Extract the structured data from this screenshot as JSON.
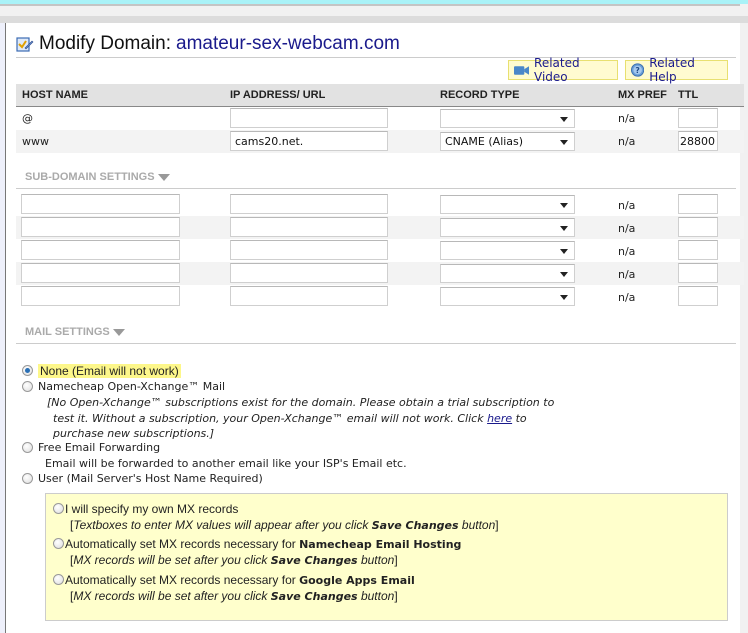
{
  "header": {
    "title": "Modify Domain:",
    "domain": "amateur-sex-webcam.com",
    "related_video": "Related Video",
    "related_help": "Related Help"
  },
  "table": {
    "columns": [
      "HOST NAME",
      "IP ADDRESS/ URL",
      "RECORD TYPE",
      "MX PREF",
      "TTL"
    ],
    "rows": [
      {
        "host": "@",
        "address": "",
        "record_type": "",
        "mx_pref": "n/a",
        "ttl": ""
      },
      {
        "host": "www",
        "address": "cams20.net.",
        "record_type": "CNAME (Alias)",
        "mx_pref": "n/a",
        "ttl": "28800"
      }
    ]
  },
  "subdomain": {
    "label": "SUB-DOMAIN SETTINGS",
    "rows": [
      {
        "host": "",
        "address": "",
        "record_type": "",
        "mx_pref": "n/a",
        "ttl": ""
      },
      {
        "host": "",
        "address": "",
        "record_type": "",
        "mx_pref": "n/a",
        "ttl": ""
      },
      {
        "host": "",
        "address": "",
        "record_type": "",
        "mx_pref": "n/a",
        "ttl": ""
      },
      {
        "host": "",
        "address": "",
        "record_type": "",
        "mx_pref": "n/a",
        "ttl": ""
      },
      {
        "host": "",
        "address": "",
        "record_type": "",
        "mx_pref": "n/a",
        "ttl": ""
      }
    ]
  },
  "mail": {
    "label": "MAIL SETTINGS",
    "selected": "none",
    "options": {
      "none": "None (Email will not work)",
      "openxchange": "Namecheap Open-Xchange™ Mail",
      "openxchange_note_1": "[No Open-Xchange™ subscriptions exist for the domain. Please obtain a trial subscription to",
      "openxchange_note_2a": "test it. Without a subscription, your Open-Xchange™ email will not work. Click ",
      "openxchange_note_link": "here",
      "openxchange_note_2b": " to",
      "openxchange_note_3": "purchase new subscriptions.]",
      "forwarding": "Free Email Forwarding",
      "forwarding_note": "Email will be forwarded to another email like your ISP's Email etc.",
      "user": "User (Mail Server's Host Name Required)"
    },
    "user_options": [
      {
        "label": "I will specify my own MX records",
        "bold": "",
        "note_pre": "Textboxes to enter MX values will appear after you click ",
        "note_bold": "Save Changes",
        "note_post": " button"
      },
      {
        "label": "Automatically set MX records necessary for ",
        "bold": "Namecheap Email Hosting",
        "note_pre": "MX records will be set after you click ",
        "note_bold": "Save Changes",
        "note_post": " button"
      },
      {
        "label": "Automatically set MX records necessary for ",
        "bold": "Google Apps Email",
        "note_pre": "MX records will be set after you click ",
        "note_bold": "Save Changes",
        "note_post": " button"
      }
    ]
  }
}
